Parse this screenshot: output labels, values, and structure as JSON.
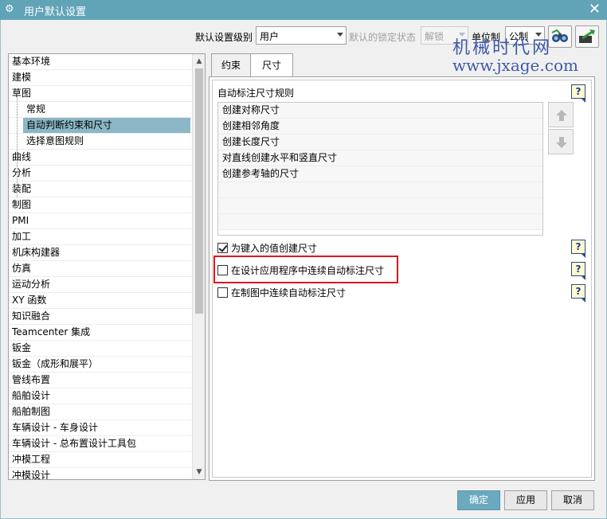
{
  "window": {
    "title": "用户默认设置",
    "close_symbol": "✕"
  },
  "toolbar": {
    "level_label": "默认设置级别",
    "level_value": "用户",
    "lock_label": "默认的锁定状态",
    "lock_value": "解锁",
    "unit_label": "单位制",
    "unit_value": "公制"
  },
  "watermark": {
    "cn": "机械时代网",
    "url": "www.jxage.com"
  },
  "tree": {
    "items": [
      {
        "label": "基本环境",
        "level": 0
      },
      {
        "label": "建模",
        "level": 0
      },
      {
        "label": "草图",
        "level": 0
      },
      {
        "label": "常规",
        "level": 1
      },
      {
        "label": "自动判断约束和尺寸",
        "level": 1,
        "selected": true
      },
      {
        "label": "选择意图规则",
        "level": 1
      },
      {
        "label": "曲线",
        "level": 0
      },
      {
        "label": "分析",
        "level": 0
      },
      {
        "label": "装配",
        "level": 0
      },
      {
        "label": "制图",
        "level": 0
      },
      {
        "label": "PMI",
        "level": 0
      },
      {
        "label": "加工",
        "level": 0
      },
      {
        "label": "机床构建器",
        "level": 0
      },
      {
        "label": "仿真",
        "level": 0
      },
      {
        "label": "运动分析",
        "level": 0
      },
      {
        "label": "XY 函数",
        "level": 0
      },
      {
        "label": "知识融合",
        "level": 0
      },
      {
        "label": "Teamcenter 集成",
        "level": 0
      },
      {
        "label": "钣金",
        "level": 0
      },
      {
        "label": "钣金（成形和展平）",
        "level": 0
      },
      {
        "label": "管线布置",
        "level": 0
      },
      {
        "label": "船舶设计",
        "level": 0
      },
      {
        "label": "船舶制图",
        "level": 0
      },
      {
        "label": "车辆设计 - 车身设计",
        "level": 0
      },
      {
        "label": "车辆设计 - 总布置设计工具包",
        "level": 0
      },
      {
        "label": "冲模工程",
        "level": 0
      },
      {
        "label": "冲模设计",
        "level": 0
      }
    ]
  },
  "tabs": [
    {
      "label": "约束"
    },
    {
      "label": "尺寸",
      "active": true
    }
  ],
  "panel": {
    "section_title": "自动标注尺寸规则",
    "help_symbol": "?",
    "rules": [
      "创建对称尺寸",
      "创建相邻角度",
      "创建长度尺寸",
      "对直线创建水平和竖直尺寸",
      "创建参考轴的尺寸"
    ],
    "options": [
      {
        "label": "为键入的值创建尺寸",
        "checked": true
      },
      {
        "label": "在设计应用程序中连续自动标注尺寸",
        "checked": false
      },
      {
        "label": "在制图中连续自动标注尺寸",
        "checked": false
      }
    ]
  },
  "buttons": {
    "ok": "确定",
    "apply": "应用",
    "cancel": "取消"
  },
  "colors": {
    "titlebar": "#61a4b8",
    "selection": "#8bb7c6",
    "highlight_box": "#e0141e",
    "primary_button": "#6aa9bf"
  }
}
